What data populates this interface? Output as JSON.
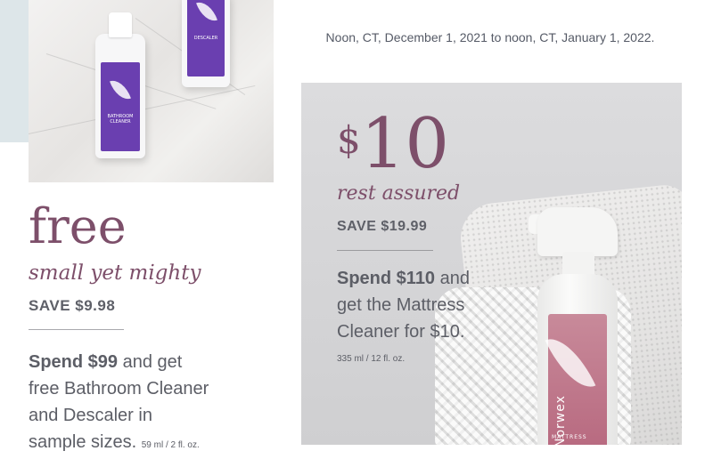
{
  "dates": {
    "range": "Noon, CT, December 1, 2021 to noon, CT, January 1, 2022."
  },
  "offer_small": {
    "price": "free",
    "tagline": "small yet mighty",
    "save": "SAVE $9.98",
    "desc_bold": "Spend $99",
    "desc_rest_1": " and get",
    "desc_line_2": "free Bathroom Cleaner",
    "desc_line_3": "and Descaler in",
    "desc_line_4": "sample sizes.",
    "size": "59 ml / 2 fl. oz."
  },
  "offer_mattress": {
    "currency": "$",
    "amount": "10",
    "tagline": "rest assured",
    "save": "SAVE $19.99",
    "desc_bold": "Spend $110",
    "desc_rest_1": " and",
    "desc_line_2": "get the Mattress",
    "desc_line_3": "Cleaner for $10.",
    "size": "335 ml / 12 fl. oz."
  },
  "product_labels": {
    "bathroom_cleaner": "BATHROOM CLEANER",
    "descaler": "DESCALER",
    "brand": "Norwex",
    "mattress": "MATTRESS"
  },
  "colors": {
    "accent": "#7d4f6a",
    "text": "#5c5e66",
    "panel": "#d6d6d8",
    "strip": "#dde6e9"
  }
}
